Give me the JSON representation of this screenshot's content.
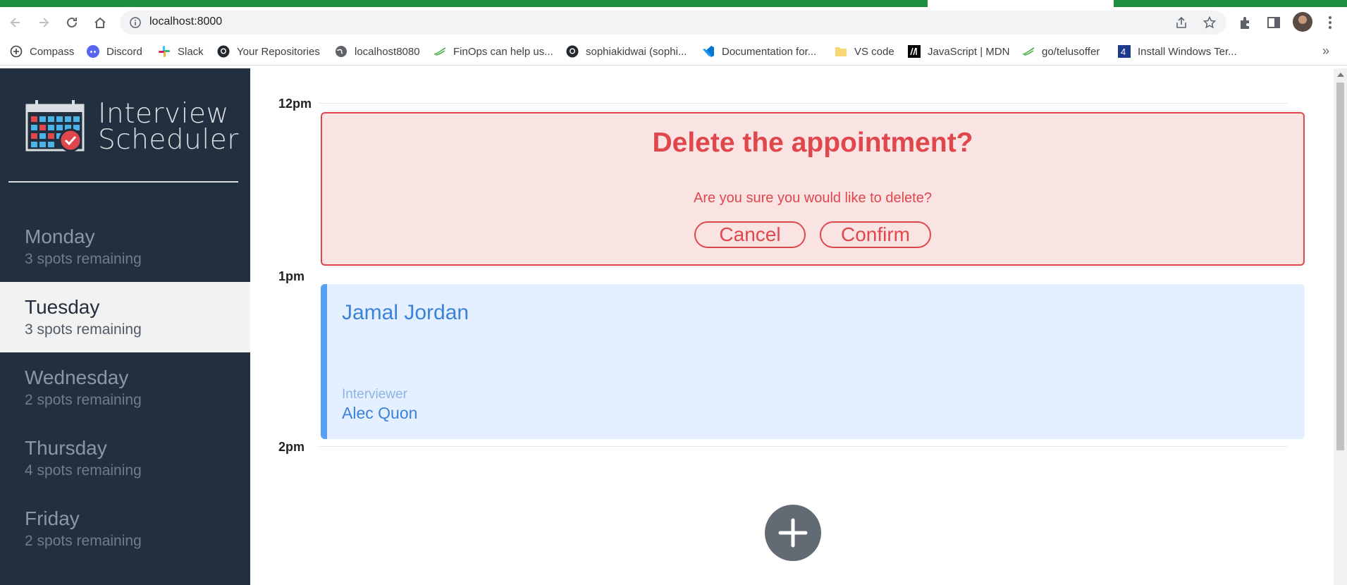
{
  "browser": {
    "url": "localhost:8000",
    "bookmarks": [
      {
        "label": "Compass",
        "icon": "compass-icon"
      },
      {
        "label": "Discord",
        "icon": "discord-icon"
      },
      {
        "label": "Slack",
        "icon": "slack-icon"
      },
      {
        "label": "Your Repositories",
        "icon": "github-icon"
      },
      {
        "label": "localhost8080",
        "icon": "globe-icon"
      },
      {
        "label": "FinOps can help us...",
        "icon": "finops-icon"
      },
      {
        "label": "sophiakidwai (sophi...",
        "icon": "github-icon"
      },
      {
        "label": "Documentation for...",
        "icon": "vscode-icon"
      },
      {
        "label": "VS code",
        "icon": "folder-icon"
      },
      {
        "label": "JavaScript | MDN",
        "icon": "mdn-icon"
      },
      {
        "label": "go/telusoffer",
        "icon": "telus-icon"
      },
      {
        "label": "Install Windows Ter...",
        "icon": "windows-terminal-icon"
      }
    ],
    "more_bookmarks": "»"
  },
  "app": {
    "title_line1": "Interview",
    "title_line2": "Scheduler"
  },
  "days": [
    {
      "name": "Monday",
      "spots": "3 spots remaining",
      "selected": false
    },
    {
      "name": "Tuesday",
      "spots": "3 spots remaining",
      "selected": true
    },
    {
      "name": "Wednesday",
      "spots": "2 spots remaining",
      "selected": false
    },
    {
      "name": "Thursday",
      "spots": "4 spots remaining",
      "selected": false
    },
    {
      "name": "Friday",
      "spots": "2 spots remaining",
      "selected": false
    }
  ],
  "schedule": {
    "times": [
      "12pm",
      "1pm",
      "2pm"
    ],
    "delete_confirm": {
      "title": "Delete the appointment?",
      "message": "Are you sure you would like to delete?",
      "cancel_label": "Cancel",
      "confirm_label": "Confirm"
    },
    "appointment": {
      "student": "Jamal Jordan",
      "interviewer_label": "Interviewer",
      "interviewer": "Alec Quon"
    }
  },
  "colors": {
    "sidebar_bg": "#222f3e",
    "danger": "#e0474c",
    "danger_bg": "#fae3e3",
    "appointment_accent": "#58a0f2",
    "appointment_bg": "#e4efff"
  }
}
